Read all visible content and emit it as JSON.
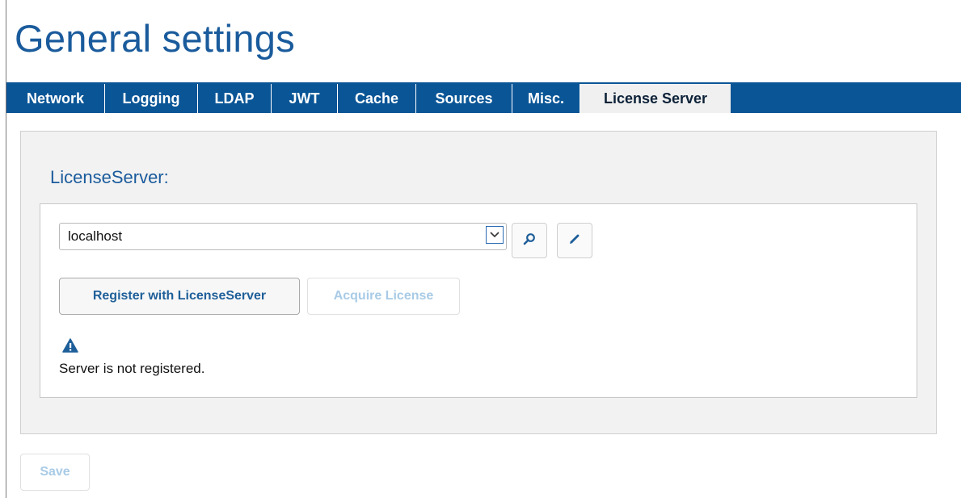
{
  "page": {
    "title": "General settings"
  },
  "tabs": [
    {
      "label": "Network",
      "active": false
    },
    {
      "label": "Logging",
      "active": false
    },
    {
      "label": "LDAP",
      "active": false
    },
    {
      "label": "JWT",
      "active": false
    },
    {
      "label": "Cache",
      "active": false
    },
    {
      "label": "Sources",
      "active": false
    },
    {
      "label": "Misc.",
      "active": false
    },
    {
      "label": "License Server",
      "active": true
    }
  ],
  "license_server": {
    "heading": "LicenseServer:",
    "server_value": "localhost",
    "register_label": "Register with LicenseServer",
    "acquire_label": "Acquire License",
    "status_text": "Server is not registered."
  },
  "icons": {
    "dropdown": "chevron-down-icon",
    "search": "search-icon",
    "edit": "pencil-icon",
    "warning": "warning-icon"
  },
  "footer": {
    "save_label": "Save"
  },
  "colors": {
    "accent": "#1a5b9c",
    "tabbar": "#0a5596",
    "disabled_text": "#a8cbe6"
  }
}
